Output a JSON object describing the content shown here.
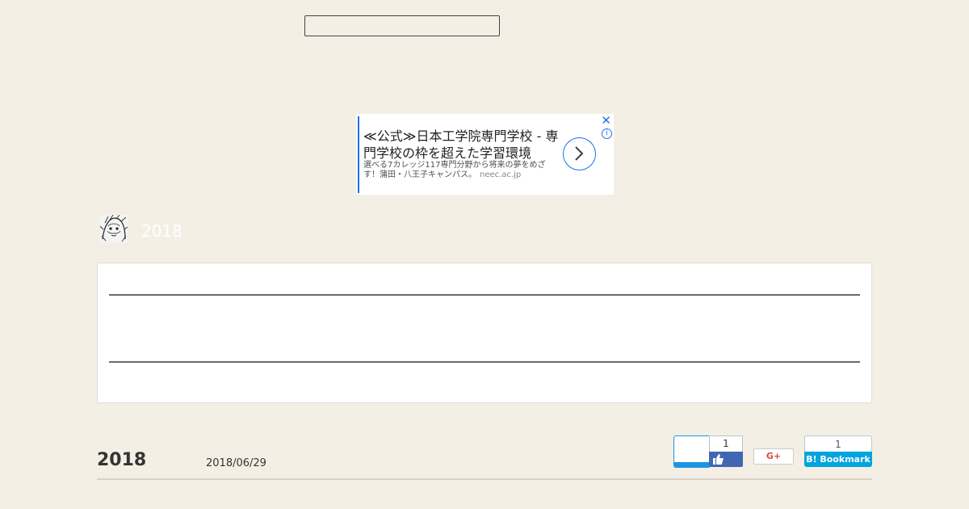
{
  "ad": {
    "title": "≪公式≫日本工学院専門学校 - 専門学校の枠を超えた学習環境",
    "description": "選べる7カレッジ117専門分野から将来の夢をめざす！蒲田・八王子キャンパス。",
    "domain": "neec.ac.jp",
    "close_glyph": "✕",
    "info_glyph": "i"
  },
  "blog": {
    "title": "2018"
  },
  "entry": {
    "title": "2018",
    "date": "2018/06/29"
  },
  "share": {
    "facebook_count": "1",
    "gplus_label": "G+",
    "hatena_count": "1",
    "hatena_label": "B! Bookmark"
  },
  "colors": {
    "background": "#f3efe5",
    "ad_accent": "#1a73e8",
    "facebook": "#4267b2",
    "hatena": "#00a4de",
    "twitter": "#1b95e0",
    "gplus": "#dd4b39"
  }
}
